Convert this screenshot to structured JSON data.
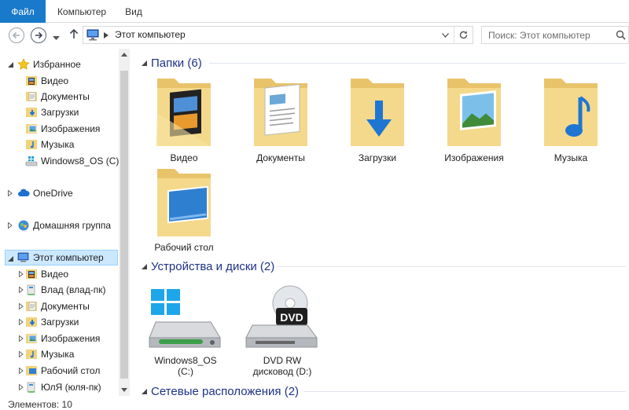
{
  "ribbon": {
    "tabs": [
      "Файл",
      "Компьютер",
      "Вид"
    ]
  },
  "address": {
    "path": "Этот компьютер",
    "search_placeholder": "Поиск: Этот компьютер"
  },
  "nav": {
    "favorites": "Избранное",
    "fav_items": [
      "Видео",
      "Документы",
      "Загрузки",
      "Изображения",
      "Музыка",
      "Windows8_OS (C)"
    ],
    "onedrive": "OneDrive",
    "homegroup": "Домашняя группа",
    "this_pc": "Этот компьютер",
    "pc_items": [
      "Видео",
      "Влад (влад-пк)",
      "Документы",
      "Загрузки",
      "Изображения",
      "Музыка",
      "Рабочий стол",
      "ЮлЯ (юля-пк)"
    ]
  },
  "groups": {
    "folders": "Папки (6)",
    "devices": "Устройства и диски (2)",
    "network": "Сетевые расположения (2)"
  },
  "folders": [
    "Видео",
    "Документы",
    "Загрузки",
    "Изображения",
    "Музыка",
    "Рабочий стол"
  ],
  "drives": [
    {
      "line1": "Windows8_OS",
      "line2": "(C:)"
    },
    {
      "line1": "DVD RW",
      "line2": "дисковод (D:)",
      "badge": "DVD"
    }
  ],
  "status": "Элементов: 10",
  "colors": {
    "accent": "#1979ca",
    "group_header": "#1e3287",
    "selection": "#cce8ff"
  }
}
